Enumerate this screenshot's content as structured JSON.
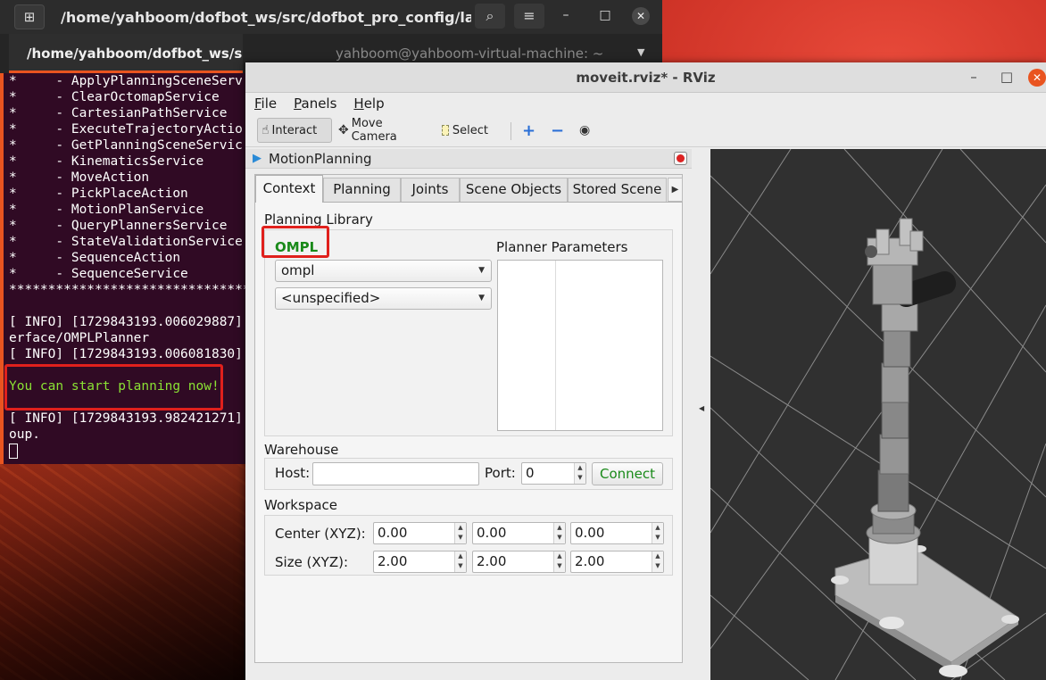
{
  "terminal": {
    "title": "/home/yahboom/dofbot_ws/src/dofbot_pro_config/launch/d...",
    "tabs": [
      {
        "label": "/home/yahboom/dofbot_ws/src/dofb..."
      },
      {
        "label": "yahboom@yahboom-virtual-machine: ~"
      }
    ],
    "icons": {
      "new_tab": "new-tab-icon",
      "search": "search-icon",
      "menu": "hamburger-menu-icon",
      "minimize": "minimize-icon",
      "maximize": "maximize-icon",
      "close": "close-icon"
    },
    "lines": [
      "*     - ApplyPlanningSceneServ",
      "*     - ClearOctomapService",
      "*     - CartesianPathService",
      "*     - ExecuteTrajectoryActio",
      "*     - GetPlanningSceneServic",
      "*     - KinematicsService",
      "*     - MoveAction",
      "*     - PickPlaceAction",
      "*     - MotionPlanService",
      "*     - QueryPlannersService",
      "*     - StateValidationService",
      "*     - SequenceAction",
      "*     - SequenceService",
      "**************************************",
      "",
      "[ INFO] [1729843193.006029887]",
      "erface/OMPLPlanner",
      "[ INFO] [1729843193.006081830]",
      "",
      "You can start planning now!",
      "",
      "[ INFO] [1729843193.982421271]",
      "oup."
    ],
    "highlight_line_index": 19,
    "colors": {
      "background": "#300a24",
      "highlight_text": "#8ae234",
      "accent": "#e95420"
    }
  },
  "rviz": {
    "title": "moveit.rviz* - RViz",
    "menu": [
      "File",
      "Panels",
      "Help"
    ],
    "toolbar": [
      {
        "label": "Interact",
        "icon": "hand-cursor-icon"
      },
      {
        "label": "Move Camera",
        "icon": "move-camera-icon"
      },
      {
        "label": "Select",
        "icon": "select-box-icon"
      },
      {
        "label": "",
        "icon": "plus-icon"
      },
      {
        "label": "",
        "icon": "minus-icon"
      },
      {
        "label": "",
        "icon": "eye-icon"
      }
    ],
    "panel": {
      "title": "MotionPlanning",
      "tabs": [
        "Context",
        "Planning",
        "Joints",
        "Scene Objects",
        "Stored Scene"
      ],
      "active_tab": "Context",
      "planning_library": {
        "label": "Planning Library",
        "name": "OMPL",
        "planner": "ompl",
        "planner_config": "<unspecified>",
        "parameters_label": "Planner Parameters"
      },
      "warehouse": {
        "label": "Warehouse",
        "host_label": "Host:",
        "host_value": "",
        "port_label": "Port:",
        "port_value": "0",
        "connect_label": "Connect"
      },
      "workspace": {
        "label": "Workspace",
        "center_label": "Center (XYZ):",
        "center": [
          "0.00",
          "0.00",
          "0.00"
        ],
        "size_label": "Size (XYZ):",
        "size": [
          "2.00",
          "2.00",
          "2.00"
        ]
      }
    },
    "colors": {
      "ompl_text": "#1a8a1a",
      "connect_text": "#1a8a1a",
      "highlight_box": "#e0201c"
    }
  }
}
